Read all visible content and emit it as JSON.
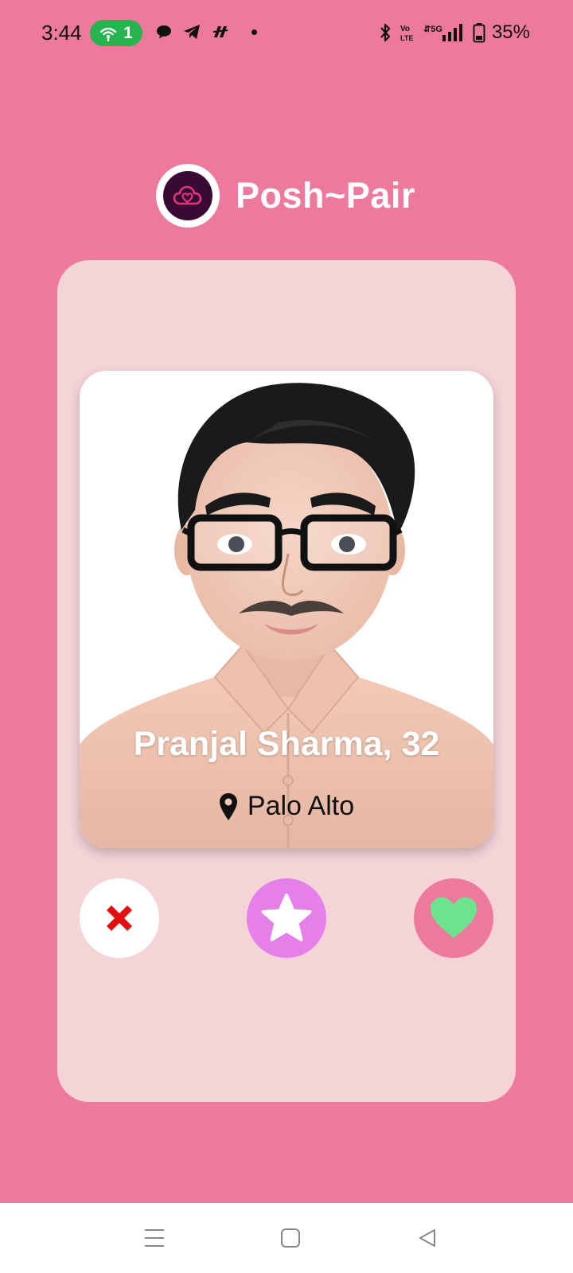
{
  "status_bar": {
    "time": "3:44",
    "hotspot_count": "1",
    "battery": "35%",
    "icons_left": [
      "hotspot-icon",
      "chat-bubble-icon",
      "telegram-icon",
      "app-icon",
      "more-dot"
    ],
    "icons_right": [
      "bluetooth-icon",
      "volte-icon",
      "5g-signal-icon",
      "battery-icon"
    ]
  },
  "header": {
    "app_name": "Posh~Pair",
    "logo_icon": "cloud-heart-icon"
  },
  "profile": {
    "name_age": "Pranjal Sharma, 32",
    "location": "Palo Alto",
    "photo": "avatar-cartoon-man-glasses"
  },
  "actions": {
    "nope": "close-icon",
    "super_like": "star-icon",
    "like": "heart-icon"
  },
  "nav_bar": {
    "items": [
      "menu-icon",
      "home-icon",
      "back-icon"
    ]
  },
  "colors": {
    "background": "#ED7A9C",
    "card": "#F5D4D8",
    "super_like_button": "#E57FEA",
    "like_heart": "#6EE38E",
    "nope_x": "#E01010",
    "logo_dark": "#3B0A34",
    "logo_accent": "#E0357A",
    "hotspot_pill": "#27B34E"
  }
}
